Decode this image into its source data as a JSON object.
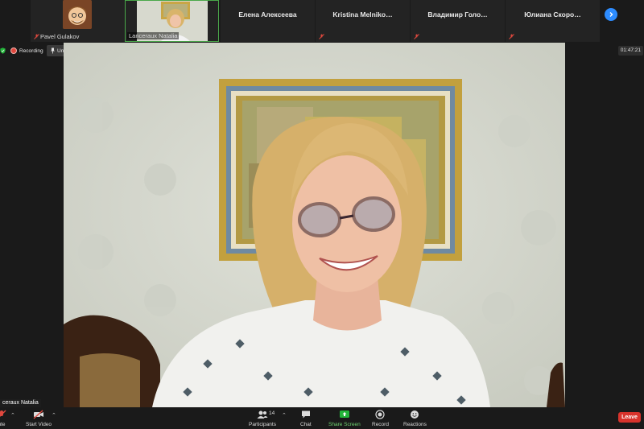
{
  "participants": [
    {
      "name": "Pavel Gulakov",
      "icon": "avatar-cartoon",
      "muted": true
    },
    {
      "name": "Lanceraux Natalia",
      "icon": "camera-thumbnail",
      "muted": false
    },
    {
      "name": "Елена Алексеева",
      "muted": false
    },
    {
      "name": "Kristina  Melniko…",
      "muted": true
    },
    {
      "name": "Владимир  Голо…",
      "muted": true
    },
    {
      "name": "Юлиана  Скоро…",
      "muted": true
    }
  ],
  "status": {
    "recording_label": "Recording",
    "unpin_label": "Unpin Video",
    "elapsed": "01:47:21"
  },
  "main_video": {
    "speaker_label": "ceraux Natalia"
  },
  "toolbar": {
    "mute_label": "ute",
    "start_video_label": "Start Video",
    "participants_label": "Participants",
    "participants_count": "14",
    "chat_label": "Chat",
    "share_label": "Share Screen",
    "record_label": "Record",
    "reactions_label": "Reactions",
    "leave_label": "Leave"
  },
  "colors": {
    "accent": "#2d8cff",
    "share_green": "#23b53a",
    "leave_red": "#d7332c",
    "recording_red": "#e0483e"
  }
}
